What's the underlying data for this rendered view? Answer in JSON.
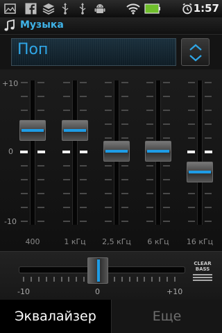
{
  "status_bar": {
    "time": "1:57",
    "icons": [
      "gallery-icon",
      "facebook-icon",
      "layers-icon",
      "usb-icon",
      "usb-icon",
      "android-icon",
      "wifi-icon",
      "battery-icon",
      "alarm-icon"
    ]
  },
  "title_bar": {
    "title": "Музыка",
    "icon": "music-note-icon"
  },
  "preset": {
    "value": "Поп"
  },
  "equalizer": {
    "scale_max": "+10",
    "scale_zero": "0",
    "scale_min": "-10",
    "bands": [
      {
        "label": "400",
        "level": 3
      },
      {
        "label": "1 кГц",
        "level": 3
      },
      {
        "label": "2,5 кГц",
        "level": 0
      },
      {
        "label": "6 кГц",
        "level": 0
      },
      {
        "label": "16 кГц",
        "level": -3
      }
    ]
  },
  "balance": {
    "min_label": "-10",
    "mid_label": "0",
    "max_label": "+10",
    "value": 0
  },
  "clear_bass": {
    "line1": "CLEAR",
    "line2": "BASS"
  },
  "tabs": {
    "equalizer": "Эквалайзер",
    "more": "Еще"
  },
  "colors": {
    "accent": "#1e9ce6",
    "title_accent": "#3fb3e8"
  }
}
